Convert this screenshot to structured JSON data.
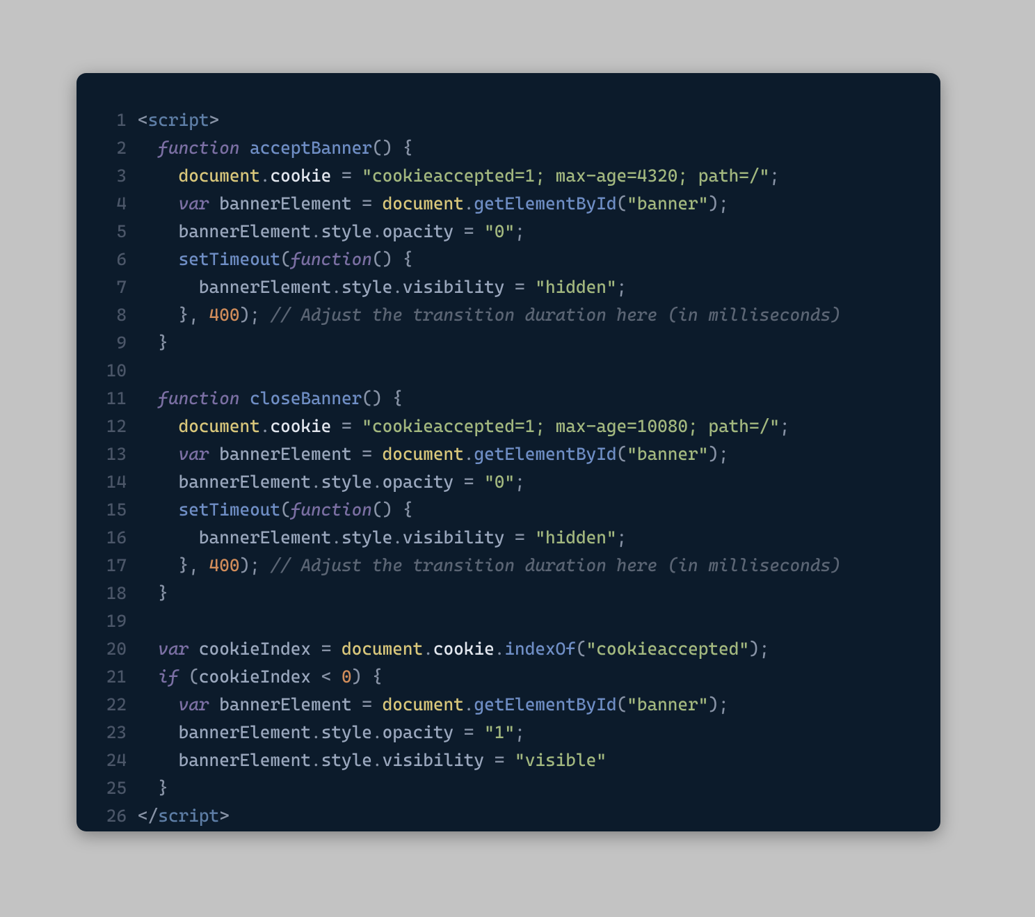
{
  "editor": {
    "lines": [
      {
        "n": "1",
        "tokens": [
          {
            "c": "tok-tag-angle",
            "t": "<"
          },
          {
            "c": "tok-tag-name",
            "t": "script"
          },
          {
            "c": "tok-tag-angle",
            "t": ">"
          }
        ]
      },
      {
        "n": "2",
        "tokens": [
          {
            "c": "",
            "t": "  "
          },
          {
            "c": "tok-keyword",
            "t": "function"
          },
          {
            "c": "",
            "t": " "
          },
          {
            "c": "tok-funcname",
            "t": "acceptBanner"
          },
          {
            "c": "tok-punct",
            "t": "()"
          },
          {
            "c": "",
            "t": " "
          },
          {
            "c": "tok-punct",
            "t": "{"
          }
        ]
      },
      {
        "n": "3",
        "tokens": [
          {
            "c": "",
            "t": "    "
          },
          {
            "c": "tok-builtin",
            "t": "document"
          },
          {
            "c": "tok-punct",
            "t": "."
          },
          {
            "c": "tok-prop",
            "t": "cookie"
          },
          {
            "c": "",
            "t": " "
          },
          {
            "c": "tok-punct",
            "t": "="
          },
          {
            "c": "",
            "t": " "
          },
          {
            "c": "tok-string",
            "t": "\"cookieaccepted=1; max-age=4320; path=/\""
          },
          {
            "c": "tok-punct",
            "t": ";"
          }
        ]
      },
      {
        "n": "4",
        "tokens": [
          {
            "c": "",
            "t": "    "
          },
          {
            "c": "tok-keyword",
            "t": "var"
          },
          {
            "c": "",
            "t": " "
          },
          {
            "c": "tok-ident",
            "t": "bannerElement"
          },
          {
            "c": "",
            "t": " "
          },
          {
            "c": "tok-punct",
            "t": "="
          },
          {
            "c": "",
            "t": " "
          },
          {
            "c": "tok-builtin",
            "t": "document"
          },
          {
            "c": "tok-punct",
            "t": "."
          },
          {
            "c": "tok-call",
            "t": "getElementById"
          },
          {
            "c": "tok-punct",
            "t": "("
          },
          {
            "c": "tok-string",
            "t": "\"banner\""
          },
          {
            "c": "tok-punct",
            "t": ");"
          }
        ]
      },
      {
        "n": "5",
        "tokens": [
          {
            "c": "",
            "t": "    "
          },
          {
            "c": "tok-ident",
            "t": "bannerElement"
          },
          {
            "c": "tok-punct",
            "t": "."
          },
          {
            "c": "tok-ident",
            "t": "style"
          },
          {
            "c": "tok-punct",
            "t": "."
          },
          {
            "c": "tok-ident",
            "t": "opacity"
          },
          {
            "c": "",
            "t": " "
          },
          {
            "c": "tok-punct",
            "t": "="
          },
          {
            "c": "",
            "t": " "
          },
          {
            "c": "tok-string",
            "t": "\"0\""
          },
          {
            "c": "tok-punct",
            "t": ";"
          }
        ]
      },
      {
        "n": "6",
        "tokens": [
          {
            "c": "",
            "t": "    "
          },
          {
            "c": "tok-call",
            "t": "setTimeout"
          },
          {
            "c": "tok-punct",
            "t": "("
          },
          {
            "c": "tok-keyword",
            "t": "function"
          },
          {
            "c": "tok-punct",
            "t": "()"
          },
          {
            "c": "",
            "t": " "
          },
          {
            "c": "tok-punct",
            "t": "{"
          }
        ]
      },
      {
        "n": "7",
        "tokens": [
          {
            "c": "",
            "t": "      "
          },
          {
            "c": "tok-ident",
            "t": "bannerElement"
          },
          {
            "c": "tok-punct",
            "t": "."
          },
          {
            "c": "tok-ident",
            "t": "style"
          },
          {
            "c": "tok-punct",
            "t": "."
          },
          {
            "c": "tok-ident",
            "t": "visibility"
          },
          {
            "c": "",
            "t": " "
          },
          {
            "c": "tok-punct",
            "t": "="
          },
          {
            "c": "",
            "t": " "
          },
          {
            "c": "tok-string",
            "t": "\"hidden\""
          },
          {
            "c": "tok-punct",
            "t": ";"
          }
        ]
      },
      {
        "n": "8",
        "tokens": [
          {
            "c": "",
            "t": "    "
          },
          {
            "c": "tok-punct",
            "t": "},"
          },
          {
            "c": "",
            "t": " "
          },
          {
            "c": "tok-number",
            "t": "400"
          },
          {
            "c": "tok-punct",
            "t": ");"
          },
          {
            "c": "",
            "t": " "
          },
          {
            "c": "tok-comment",
            "t": "// Adjust the transition duration here (in milliseconds)"
          }
        ]
      },
      {
        "n": "9",
        "tokens": [
          {
            "c": "",
            "t": "  "
          },
          {
            "c": "tok-punct",
            "t": "}"
          }
        ]
      },
      {
        "n": "10",
        "tokens": [
          {
            "c": "",
            "t": ""
          }
        ]
      },
      {
        "n": "11",
        "tokens": [
          {
            "c": "",
            "t": "  "
          },
          {
            "c": "tok-keyword",
            "t": "function"
          },
          {
            "c": "",
            "t": " "
          },
          {
            "c": "tok-funcname",
            "t": "closeBanner"
          },
          {
            "c": "tok-punct",
            "t": "()"
          },
          {
            "c": "",
            "t": " "
          },
          {
            "c": "tok-punct",
            "t": "{"
          }
        ]
      },
      {
        "n": "12",
        "tokens": [
          {
            "c": "",
            "t": "    "
          },
          {
            "c": "tok-builtin",
            "t": "document"
          },
          {
            "c": "tok-punct",
            "t": "."
          },
          {
            "c": "tok-prop",
            "t": "cookie"
          },
          {
            "c": "",
            "t": " "
          },
          {
            "c": "tok-punct",
            "t": "="
          },
          {
            "c": "",
            "t": " "
          },
          {
            "c": "tok-string",
            "t": "\"cookieaccepted=1; max-age=10080; path=/\""
          },
          {
            "c": "tok-punct",
            "t": ";"
          }
        ]
      },
      {
        "n": "13",
        "tokens": [
          {
            "c": "",
            "t": "    "
          },
          {
            "c": "tok-keyword",
            "t": "var"
          },
          {
            "c": "",
            "t": " "
          },
          {
            "c": "tok-ident",
            "t": "bannerElement"
          },
          {
            "c": "",
            "t": " "
          },
          {
            "c": "tok-punct",
            "t": "="
          },
          {
            "c": "",
            "t": " "
          },
          {
            "c": "tok-builtin",
            "t": "document"
          },
          {
            "c": "tok-punct",
            "t": "."
          },
          {
            "c": "tok-call",
            "t": "getElementById"
          },
          {
            "c": "tok-punct",
            "t": "("
          },
          {
            "c": "tok-string",
            "t": "\"banner\""
          },
          {
            "c": "tok-punct",
            "t": ");"
          }
        ]
      },
      {
        "n": "14",
        "tokens": [
          {
            "c": "",
            "t": "    "
          },
          {
            "c": "tok-ident",
            "t": "bannerElement"
          },
          {
            "c": "tok-punct",
            "t": "."
          },
          {
            "c": "tok-ident",
            "t": "style"
          },
          {
            "c": "tok-punct",
            "t": "."
          },
          {
            "c": "tok-ident",
            "t": "opacity"
          },
          {
            "c": "",
            "t": " "
          },
          {
            "c": "tok-punct",
            "t": "="
          },
          {
            "c": "",
            "t": " "
          },
          {
            "c": "tok-string",
            "t": "\"0\""
          },
          {
            "c": "tok-punct",
            "t": ";"
          }
        ]
      },
      {
        "n": "15",
        "tokens": [
          {
            "c": "",
            "t": "    "
          },
          {
            "c": "tok-call",
            "t": "setTimeout"
          },
          {
            "c": "tok-punct",
            "t": "("
          },
          {
            "c": "tok-keyword",
            "t": "function"
          },
          {
            "c": "tok-punct",
            "t": "()"
          },
          {
            "c": "",
            "t": " "
          },
          {
            "c": "tok-punct",
            "t": "{"
          }
        ]
      },
      {
        "n": "16",
        "tokens": [
          {
            "c": "",
            "t": "      "
          },
          {
            "c": "tok-ident",
            "t": "bannerElement"
          },
          {
            "c": "tok-punct",
            "t": "."
          },
          {
            "c": "tok-ident",
            "t": "style"
          },
          {
            "c": "tok-punct",
            "t": "."
          },
          {
            "c": "tok-ident",
            "t": "visibility"
          },
          {
            "c": "",
            "t": " "
          },
          {
            "c": "tok-punct",
            "t": "="
          },
          {
            "c": "",
            "t": " "
          },
          {
            "c": "tok-string",
            "t": "\"hidden\""
          },
          {
            "c": "tok-punct",
            "t": ";"
          }
        ]
      },
      {
        "n": "17",
        "tokens": [
          {
            "c": "",
            "t": "    "
          },
          {
            "c": "tok-punct",
            "t": "},"
          },
          {
            "c": "",
            "t": " "
          },
          {
            "c": "tok-number",
            "t": "400"
          },
          {
            "c": "tok-punct",
            "t": ");"
          },
          {
            "c": "",
            "t": " "
          },
          {
            "c": "tok-comment",
            "t": "// Adjust the transition duration here (in milliseconds)"
          }
        ]
      },
      {
        "n": "18",
        "tokens": [
          {
            "c": "",
            "t": "  "
          },
          {
            "c": "tok-punct",
            "t": "}"
          }
        ]
      },
      {
        "n": "19",
        "tokens": [
          {
            "c": "",
            "t": ""
          }
        ]
      },
      {
        "n": "20",
        "tokens": [
          {
            "c": "",
            "t": "  "
          },
          {
            "c": "tok-keyword",
            "t": "var"
          },
          {
            "c": "",
            "t": " "
          },
          {
            "c": "tok-ident",
            "t": "cookieIndex"
          },
          {
            "c": "",
            "t": " "
          },
          {
            "c": "tok-punct",
            "t": "="
          },
          {
            "c": "",
            "t": " "
          },
          {
            "c": "tok-builtin",
            "t": "document"
          },
          {
            "c": "tok-punct",
            "t": "."
          },
          {
            "c": "tok-prop",
            "t": "cookie"
          },
          {
            "c": "tok-punct",
            "t": "."
          },
          {
            "c": "tok-call",
            "t": "indexOf"
          },
          {
            "c": "tok-punct",
            "t": "("
          },
          {
            "c": "tok-string",
            "t": "\"cookieaccepted\""
          },
          {
            "c": "tok-punct",
            "t": ");"
          }
        ]
      },
      {
        "n": "21",
        "tokens": [
          {
            "c": "",
            "t": "  "
          },
          {
            "c": "tok-keyword",
            "t": "if"
          },
          {
            "c": "",
            "t": " "
          },
          {
            "c": "tok-punct",
            "t": "("
          },
          {
            "c": "tok-ident",
            "t": "cookieIndex"
          },
          {
            "c": "",
            "t": " "
          },
          {
            "c": "tok-punct",
            "t": "<"
          },
          {
            "c": "",
            "t": " "
          },
          {
            "c": "tok-number",
            "t": "0"
          },
          {
            "c": "tok-punct",
            "t": ")"
          },
          {
            "c": "",
            "t": " "
          },
          {
            "c": "tok-punct",
            "t": "{"
          }
        ]
      },
      {
        "n": "22",
        "tokens": [
          {
            "c": "",
            "t": "    "
          },
          {
            "c": "tok-keyword",
            "t": "var"
          },
          {
            "c": "",
            "t": " "
          },
          {
            "c": "tok-ident",
            "t": "bannerElement"
          },
          {
            "c": "",
            "t": " "
          },
          {
            "c": "tok-punct",
            "t": "="
          },
          {
            "c": "",
            "t": " "
          },
          {
            "c": "tok-builtin",
            "t": "document"
          },
          {
            "c": "tok-punct",
            "t": "."
          },
          {
            "c": "tok-call",
            "t": "getElementById"
          },
          {
            "c": "tok-punct",
            "t": "("
          },
          {
            "c": "tok-string",
            "t": "\"banner\""
          },
          {
            "c": "tok-punct",
            "t": ");"
          }
        ]
      },
      {
        "n": "23",
        "tokens": [
          {
            "c": "",
            "t": "    "
          },
          {
            "c": "tok-ident",
            "t": "bannerElement"
          },
          {
            "c": "tok-punct",
            "t": "."
          },
          {
            "c": "tok-ident",
            "t": "style"
          },
          {
            "c": "tok-punct",
            "t": "."
          },
          {
            "c": "tok-ident",
            "t": "opacity"
          },
          {
            "c": "",
            "t": " "
          },
          {
            "c": "tok-punct",
            "t": "="
          },
          {
            "c": "",
            "t": " "
          },
          {
            "c": "tok-string",
            "t": "\"1\""
          },
          {
            "c": "tok-punct",
            "t": ";"
          }
        ]
      },
      {
        "n": "24",
        "tokens": [
          {
            "c": "",
            "t": "    "
          },
          {
            "c": "tok-ident",
            "t": "bannerElement"
          },
          {
            "c": "tok-punct",
            "t": "."
          },
          {
            "c": "tok-ident",
            "t": "style"
          },
          {
            "c": "tok-punct",
            "t": "."
          },
          {
            "c": "tok-ident",
            "t": "visibility"
          },
          {
            "c": "",
            "t": " "
          },
          {
            "c": "tok-punct",
            "t": "="
          },
          {
            "c": "",
            "t": " "
          },
          {
            "c": "tok-string",
            "t": "\"visible\""
          }
        ]
      },
      {
        "n": "25",
        "tokens": [
          {
            "c": "",
            "t": "  "
          },
          {
            "c": "tok-punct",
            "t": "}"
          }
        ]
      },
      {
        "n": "26",
        "tokens": [
          {
            "c": "tok-tag-angle",
            "t": "</"
          },
          {
            "c": "tok-tag-name",
            "t": "script"
          },
          {
            "c": "tok-tag-angle",
            "t": ">"
          }
        ]
      }
    ]
  }
}
